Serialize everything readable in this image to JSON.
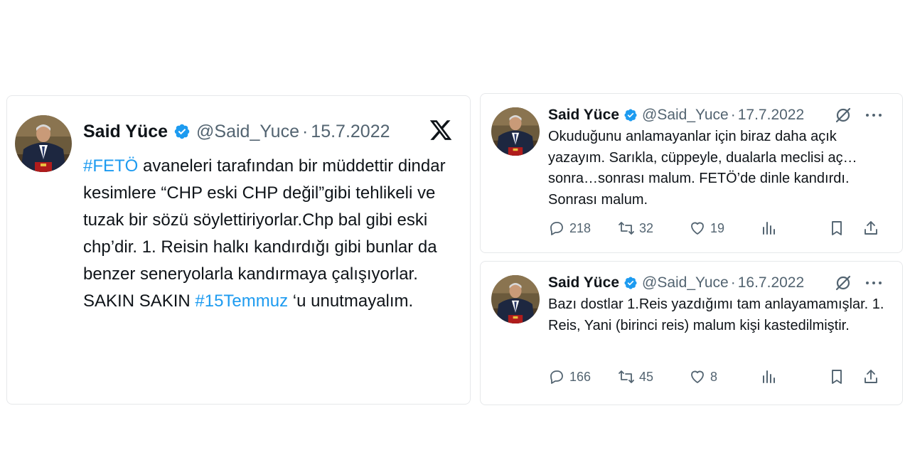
{
  "main_tweet": {
    "author_name": "Said Yüce",
    "handle": "@Said_Yuce",
    "separator": "·",
    "date": "15.7.2022",
    "text_parts": [
      {
        "text": "#FETÖ",
        "hashtag": true
      },
      {
        "text": " avaneleri tarafından bir müddettir dindar kesimlere “CHP eski CHP değil”gibi tehlikeli ve tuzak bir sözü söylettiriyorlar.Chp bal gibi eski chp’dir. 1. Reisin halkı kandırdığı gibi bunlar da benzer seneryolarla kandırmaya çalışıyorlar. SAKIN SAKIN ",
        "hashtag": false
      },
      {
        "text": "#15Temmuz",
        "hashtag": true
      },
      {
        "text": " ‘u unutmayalım.",
        "hashtag": false
      }
    ],
    "icons": {
      "verified": "verified-badge-icon",
      "platform": "x-logo-icon"
    }
  },
  "replies": [
    {
      "author_name": "Said Yüce",
      "handle": "@Said_Yuce",
      "separator": "·",
      "date": "17.7.2022",
      "text": "Okuduğunu anlamayanlar için biraz daha açık yazayım. Sarıkla, cüppeyle, dualarla meclisi aç… sonra…sonrası malum. FETÖ’de dinle kandırdı. Sonrası malum.",
      "reply_count": "218",
      "retweet_count": "32",
      "like_count": "19"
    },
    {
      "author_name": "Said Yüce",
      "handle": "@Said_Yuce",
      "separator": "·",
      "date": "16.7.2022",
      "text": "Bazı dostlar 1.Reis yazdığımı tam anlayamamışlar. 1. Reis, Yani (birinci reis) malum kişi kastedilmiştir.",
      "reply_count": "166",
      "retweet_count": "45",
      "like_count": "8"
    }
  ],
  "colors": {
    "hashtag": "#1d9bf0",
    "verified": "#1d9bf0",
    "muted": "#536471",
    "text": "#0f1419",
    "border": "#e6e8ea"
  }
}
